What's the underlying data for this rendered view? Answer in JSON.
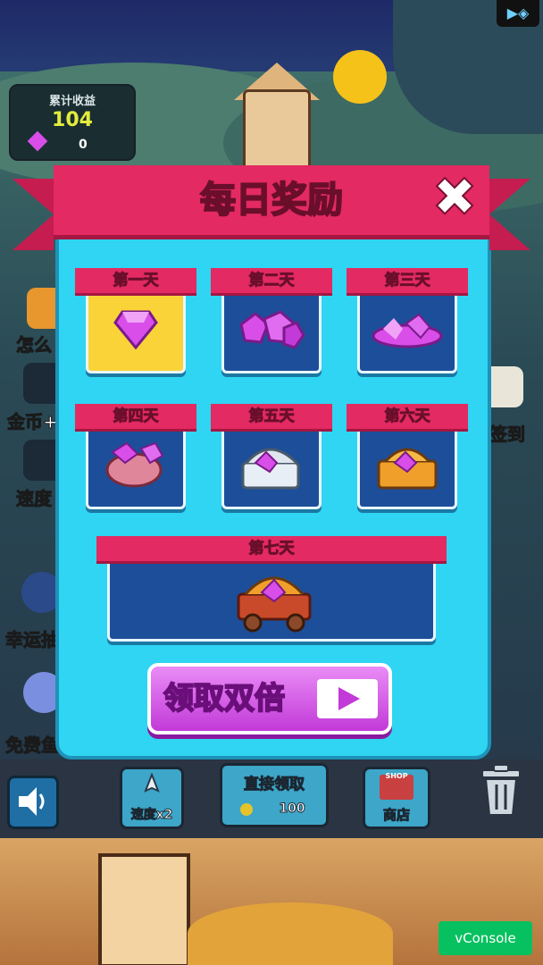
{
  "earnings": {
    "title": "累计收益",
    "value": "104",
    "gems": "0"
  },
  "modal": {
    "title": "每日奖励",
    "close_icon": "✖"
  },
  "days": [
    {
      "label": "第一天",
      "claimed": true
    },
    {
      "label": "第二天",
      "claimed": false
    },
    {
      "label": "第三天",
      "claimed": false
    },
    {
      "label": "第四天",
      "claimed": false
    },
    {
      "label": "第五天",
      "claimed": false
    },
    {
      "label": "第六天",
      "claimed": false
    },
    {
      "label": "第七天",
      "claimed": false
    }
  ],
  "double_button": {
    "label": "领取双倍"
  },
  "side_left": [
    "怎么",
    "金币+",
    "速度",
    "幸运抽",
    "免费鱼"
  ],
  "side_right": "签到",
  "bottom_bar": {
    "speed_label": "速度x2",
    "direct_label": "直接领取",
    "direct_value": "100",
    "shop_label": "商店",
    "shop_sign": "SHOP"
  },
  "vconsole": "vConsole",
  "colors": {
    "pink": "#e32a62",
    "cyan": "#2fd5f2",
    "navy": "#1d4e9a",
    "gold": "#f9d338",
    "magenta": "#c23ad8"
  }
}
